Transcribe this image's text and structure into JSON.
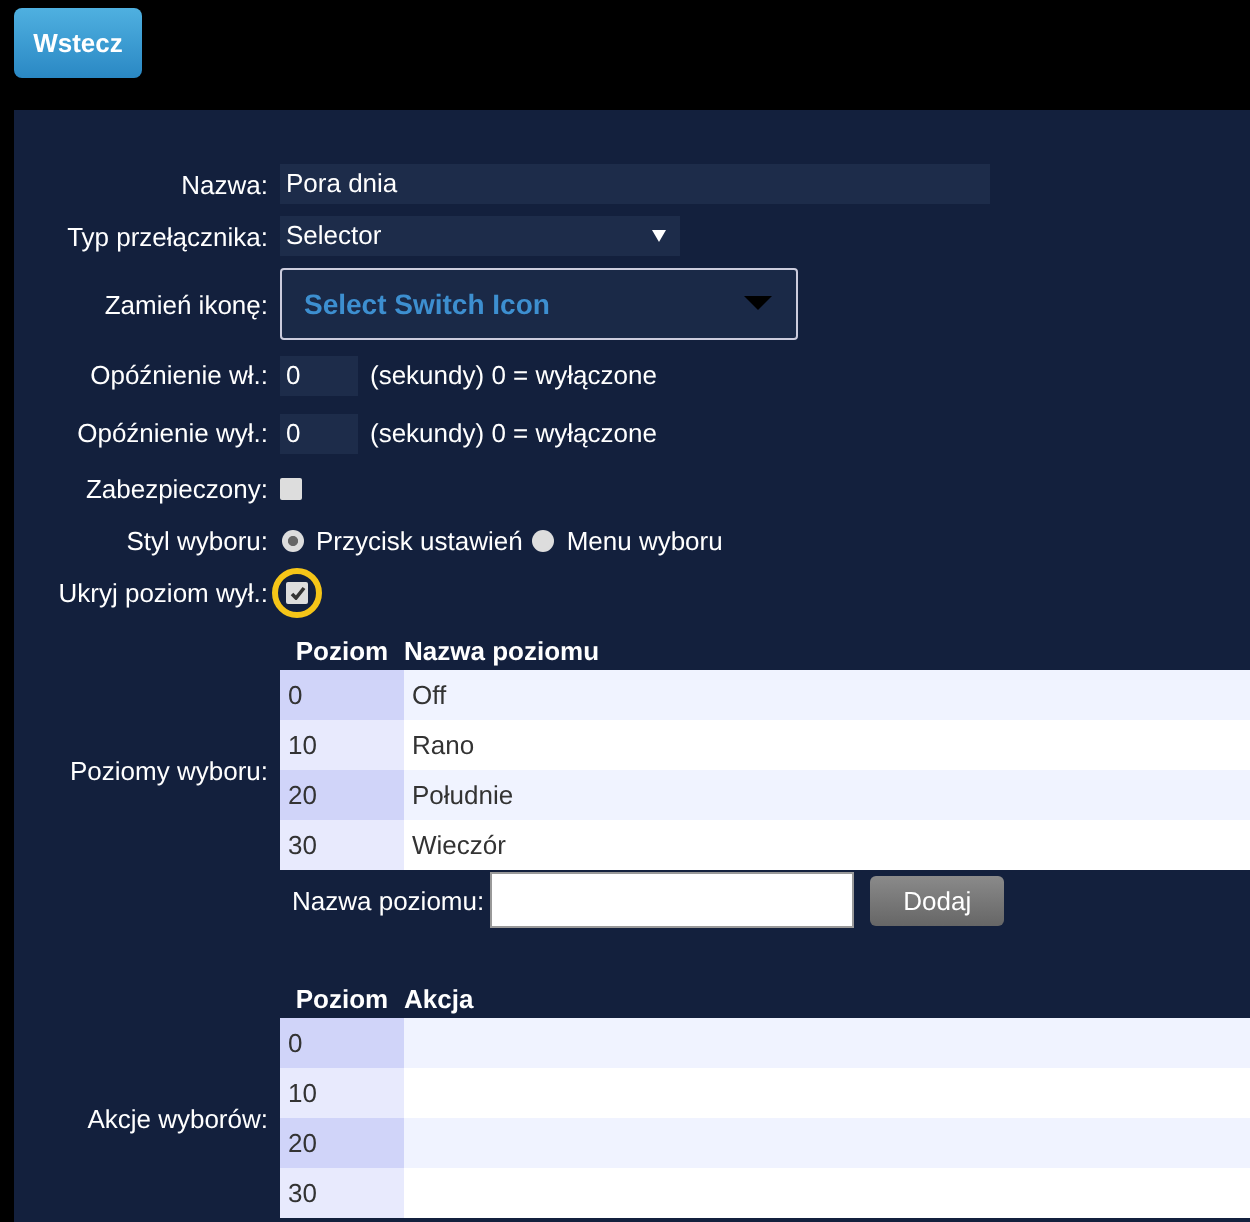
{
  "back_button": "Wstecz",
  "form": {
    "name": {
      "label": "Nazwa:",
      "value": "Pora dnia"
    },
    "switch_type": {
      "label": "Typ przełącznika:",
      "value": "Selector"
    },
    "icon": {
      "label": "Zamień ikonę:",
      "value": "Select Switch Icon"
    },
    "on_delay": {
      "label": "Opóźnienie wł.:",
      "value": "0",
      "hint": "(sekundy) 0 = wyłączone"
    },
    "off_delay": {
      "label": "Opóźnienie wył.:",
      "value": "0",
      "hint": "(sekundy) 0 = wyłączone"
    },
    "protected": {
      "label": "Zabezpieczony:",
      "checked": false
    },
    "selector_style": {
      "label": "Styl wyboru:",
      "options": [
        {
          "label": "Przycisk ustawień",
          "selected": true
        },
        {
          "label": "Menu wyboru",
          "selected": false
        }
      ]
    },
    "hide_off_level": {
      "label": "Ukryj poziom wył.:",
      "checked": true,
      "highlighted": true
    }
  },
  "levels": {
    "label": "Poziomy wyboru:",
    "columns": [
      "Poziom",
      "Nazwa poziomu"
    ],
    "rows": [
      {
        "level": "0",
        "name": "Off"
      },
      {
        "level": "10",
        "name": "Rano"
      },
      {
        "level": "20",
        "name": "Południe"
      },
      {
        "level": "30",
        "name": "Wieczór"
      }
    ],
    "new_level": {
      "label": "Nazwa poziomu:",
      "button": "Dodaj"
    }
  },
  "actions": {
    "label": "Akcje wyborów:",
    "columns": [
      "Poziom",
      "Akcja"
    ],
    "rows": [
      {
        "level": "0"
      },
      {
        "level": "10"
      },
      {
        "level": "20"
      },
      {
        "level": "30"
      }
    ]
  }
}
